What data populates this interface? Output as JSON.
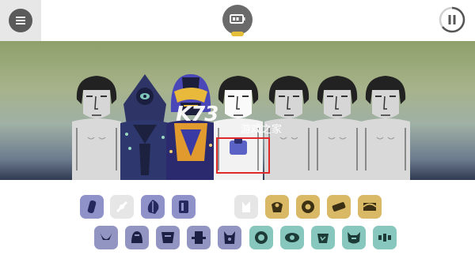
{
  "toolbar": {
    "menu_icon": "hamburger-icon",
    "battery_icon": "battery-icon",
    "pause_icon": "pause-icon"
  },
  "stage": {
    "performer_count": 7,
    "characters": [
      {
        "costume": "default"
      },
      {
        "costume": "dark-blue-hood"
      },
      {
        "costume": "purple-gold-helmet"
      },
      {
        "costume": "default-selected"
      },
      {
        "costume": "default"
      },
      {
        "costume": "default"
      },
      {
        "costume": "default"
      }
    ]
  },
  "watermark": {
    "logo": "K73",
    "text": "游戏之家"
  },
  "palette": {
    "row1": [
      {
        "name": "beats-icon-1",
        "color": "#8f92c9"
      },
      {
        "name": "beats-icon-2-disabled",
        "color": "#e6e6e6"
      },
      {
        "name": "beats-icon-3",
        "color": "#8f92c9"
      },
      {
        "name": "beats-icon-4",
        "color": "#8f92c9"
      },
      {
        "name": "effects-icon-1-disabled",
        "color": "#e6e6e6"
      },
      {
        "name": "effects-icon-2",
        "color": "#d9b866"
      },
      {
        "name": "effects-icon-3",
        "color": "#d9b866"
      },
      {
        "name": "effects-icon-4",
        "color": "#d9b866"
      },
      {
        "name": "effects-icon-5",
        "color": "#d9b866"
      }
    ],
    "row2": [
      {
        "name": "melody-icon-1",
        "color": "#9295c2"
      },
      {
        "name": "melody-icon-2",
        "color": "#9295c2"
      },
      {
        "name": "melody-icon-3",
        "color": "#9295c2"
      },
      {
        "name": "melody-icon-4",
        "color": "#9295c2"
      },
      {
        "name": "melody-icon-5",
        "color": "#9295c2"
      },
      {
        "name": "voice-icon-1",
        "color": "#87c7bd"
      },
      {
        "name": "voice-icon-2",
        "color": "#87c7bd"
      },
      {
        "name": "voice-icon-3",
        "color": "#87c7bd"
      },
      {
        "name": "voice-icon-4",
        "color": "#87c7bd"
      },
      {
        "name": "voice-icon-5",
        "color": "#87c7bd"
      }
    ]
  },
  "colors": {
    "accent_gold": "#e6bf3a",
    "highlight_red": "#e02a2a"
  }
}
